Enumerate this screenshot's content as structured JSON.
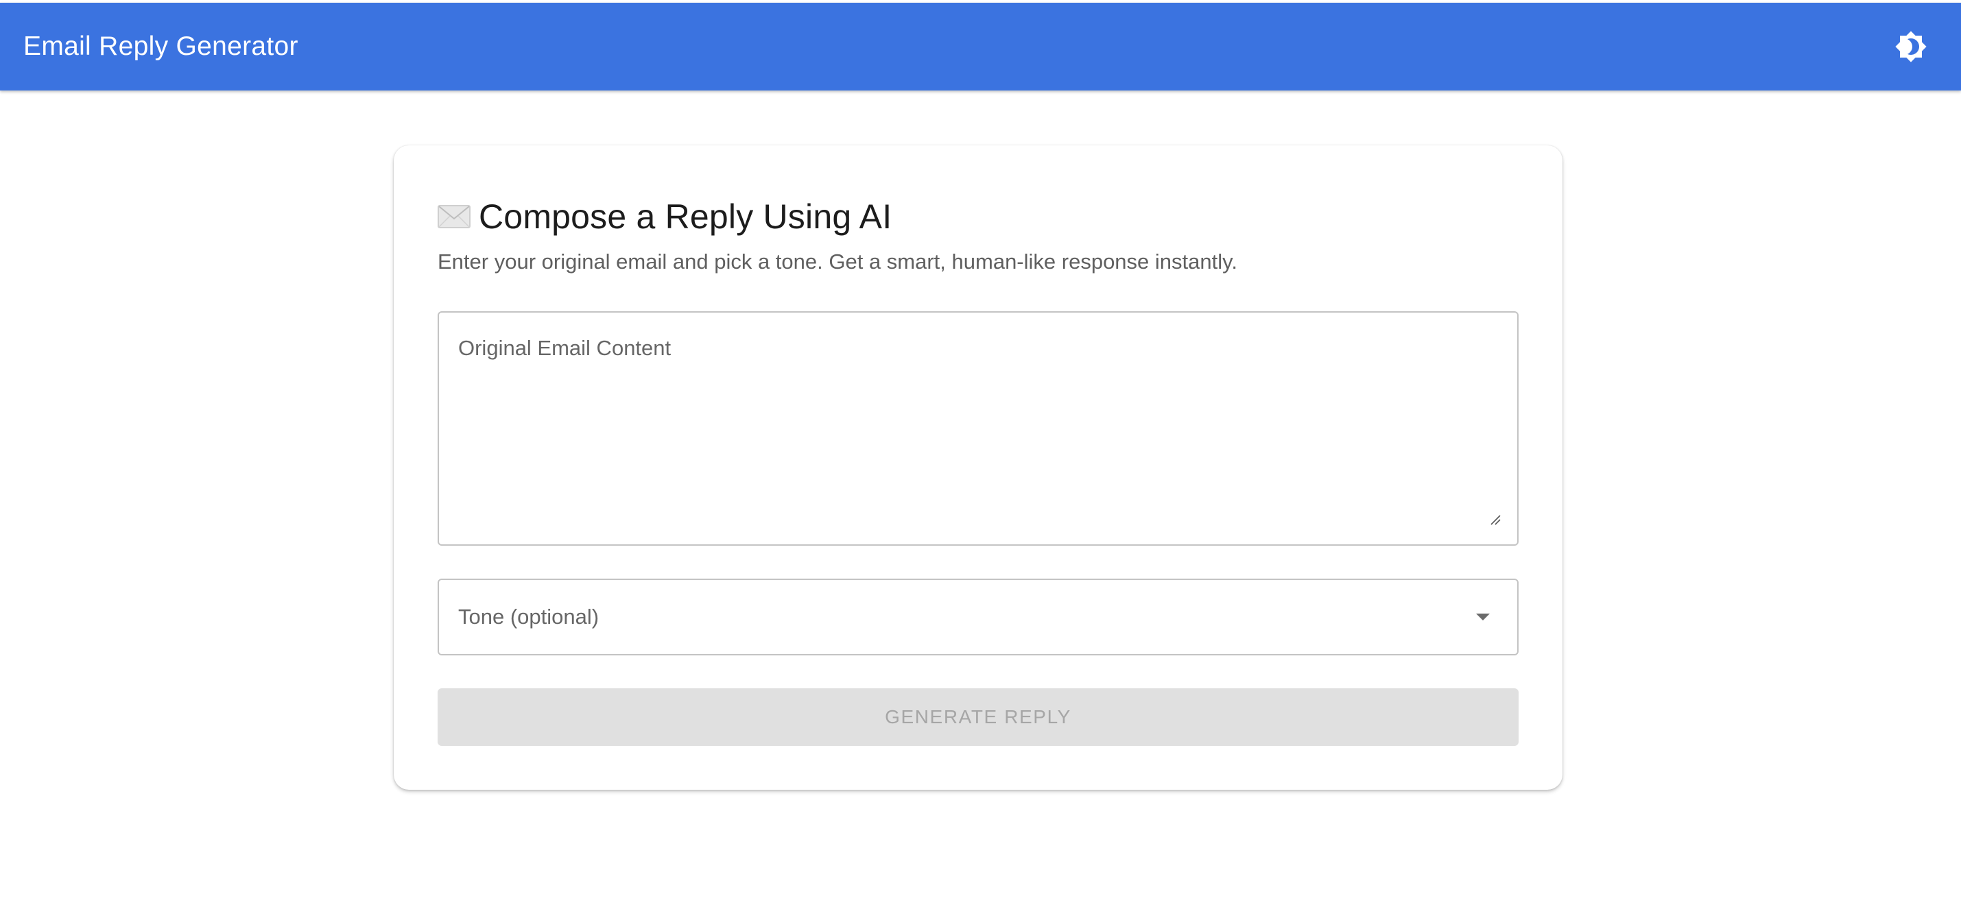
{
  "app_bar": {
    "title": "Email Reply Generator",
    "theme_toggle_icon": "brightness-toggle-icon",
    "background_color": "#3b73e0"
  },
  "card": {
    "heading_icon": "envelope-icon",
    "heading": "Compose a Reply Using AI",
    "subtitle": "Enter your original email and pick a tone. Get a smart, human-like response instantly.",
    "email_field": {
      "placeholder": "Original Email Content",
      "value": ""
    },
    "tone_select": {
      "label": "Tone (optional)",
      "selected": ""
    },
    "generate_button": {
      "label": "Generate Reply",
      "disabled": true
    }
  }
}
